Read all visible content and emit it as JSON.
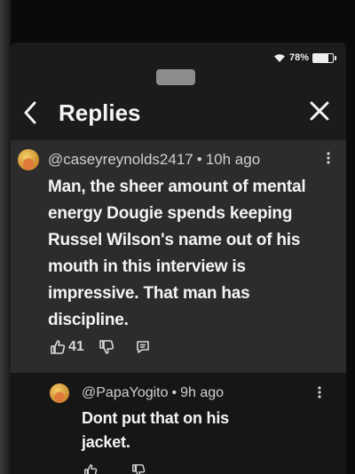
{
  "status": {
    "battery_text": "78%",
    "battery_level": 0.78
  },
  "header": {
    "title": "Replies",
    "back_glyph": "‹",
    "close_glyph": "✕"
  },
  "comment": {
    "handle": "@caseyreynolds2417",
    "separator": "•",
    "time": "10h ago",
    "body": "Man, the sheer amount of mental energy Dougie spends keeping Russel Wilson's name out of his mouth in this interview is impressive. That man has discipline.",
    "likes": "41",
    "avatar_icon": "emoji-avatar-icon"
  },
  "reply": {
    "handle": "@PapaYogito",
    "separator": "•",
    "time": "9h ago",
    "body": "Dont put that on his jacket.",
    "avatar_icon": "emoji-avatar-icon"
  },
  "colors": {
    "background": "#1b1b1b",
    "comment_bg": "#2c2c2c",
    "reply_bg": "#161616",
    "text": "#f4f4f4"
  }
}
